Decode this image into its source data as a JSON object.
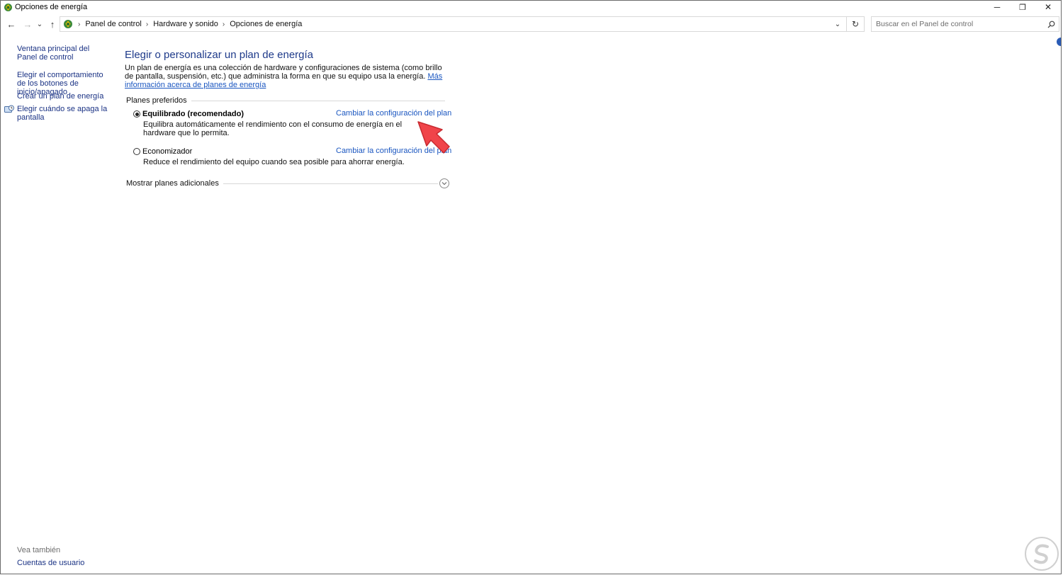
{
  "window": {
    "title": "Opciones de energía",
    "controls": {
      "minimize": "─",
      "restore": "❐",
      "close": "✕"
    }
  },
  "navigation": {
    "back_icon": "←",
    "forward_icon": "→",
    "recent_icon": "⌄",
    "up_icon": "↑",
    "breadcrumbs": [
      "Panel de control",
      "Hardware y sonido",
      "Opciones de energía"
    ],
    "separator": "›",
    "dropdown_icon": "⌄",
    "refresh_icon": "↻"
  },
  "search": {
    "placeholder": "Buscar en el Panel de control",
    "value": ""
  },
  "sidebar": {
    "items": [
      {
        "label": "Ventana principal del Panel de control"
      },
      {
        "label": "Elegir el comportamiento de los botones de inicio/apagado"
      },
      {
        "label": "Crear un plan de energía"
      },
      {
        "label": "Elegir cuándo se apaga la pantalla"
      }
    ],
    "see_also": {
      "heading": "Vea también",
      "items": [
        {
          "label": "Cuentas de usuario"
        }
      ]
    }
  },
  "main": {
    "title": "Elegir o personalizar un plan de energía",
    "intro_text": "Un plan de energía es una colección de hardware y configuraciones de sistema (como brillo de pantalla, suspensión, etc.) que administra la forma en que su equipo usa la energía. ",
    "intro_link": "Más información acerca de planes de energía",
    "preferred_heading": "Planes preferidos",
    "plans": [
      {
        "name": "Equilibrado (recomendado)",
        "selected": true,
        "link": "Cambiar la configuración del plan",
        "description": "Equilibra automáticamente el rendimiento con el consumo de energía en el hardware que lo permita."
      },
      {
        "name": "Economizador",
        "selected": false,
        "link": "Cambiar la configuración del plan",
        "description": "Reduce el rendimiento del equipo cuando sea posible para ahorrar energía."
      }
    ],
    "more_plans_label": "Mostrar planes adicionales"
  },
  "colors": {
    "link": "#1a56c0",
    "title": "#1e3a8a",
    "annotation_arrow": "#f0444a"
  }
}
